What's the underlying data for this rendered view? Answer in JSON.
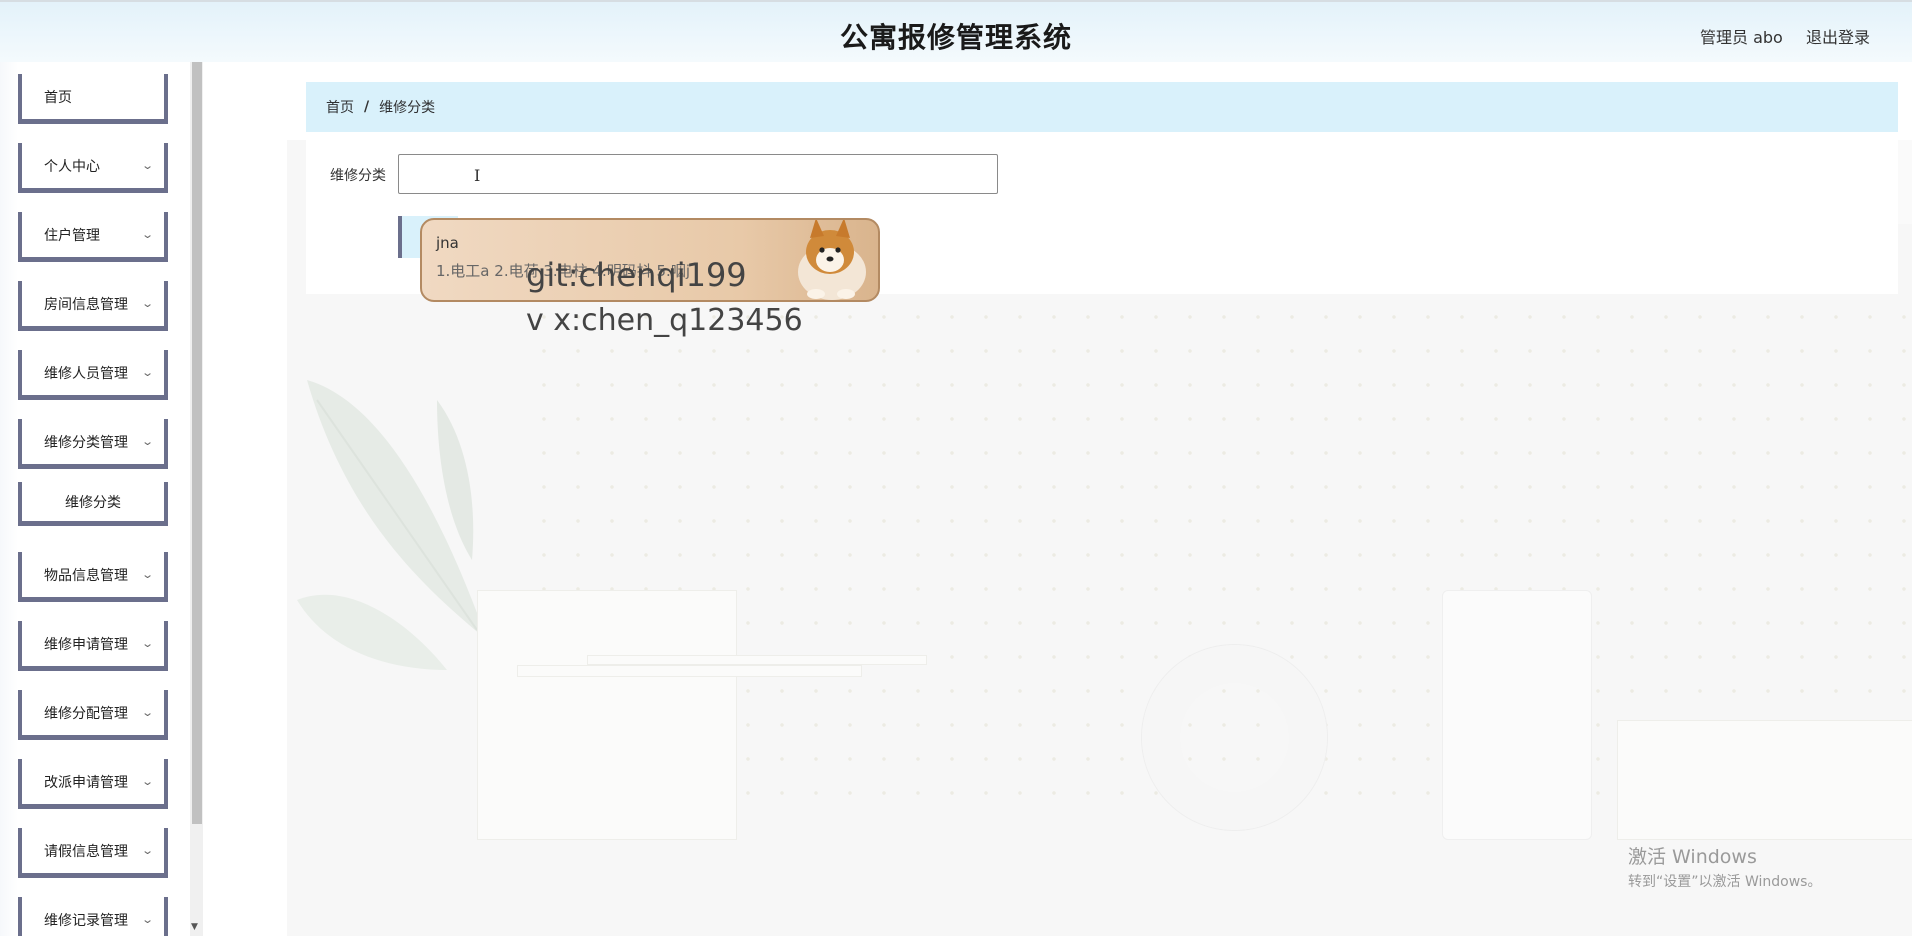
{
  "header": {
    "title": "公寓报修管理系统",
    "user": "管理员 abo",
    "logout": "退出登录"
  },
  "sidebar": {
    "items": [
      {
        "label": "首页",
        "expandable": false
      },
      {
        "label": "个人中心",
        "expandable": true
      },
      {
        "label": "住户管理",
        "expandable": true
      },
      {
        "label": "房间信息管理",
        "expandable": true
      },
      {
        "label": "维修人员管理",
        "expandable": true
      },
      {
        "label": "维修分类管理",
        "expandable": true
      },
      {
        "label": "维修分类",
        "expandable": false,
        "submenu": true
      },
      {
        "label": "物品信息管理",
        "expandable": true
      },
      {
        "label": "维修申请管理",
        "expandable": true
      },
      {
        "label": "维修分配管理",
        "expandable": true
      },
      {
        "label": "改派申请管理",
        "expandable": true
      },
      {
        "label": "请假信息管理",
        "expandable": true
      },
      {
        "label": "维修记录管理",
        "expandable": true
      }
    ]
  },
  "breadcrumb": {
    "home": "首页",
    "separator": "/",
    "current": "维修分类"
  },
  "form": {
    "label": "维修分类",
    "value": ""
  },
  "ime": {
    "composition": "jna",
    "candidates": "1.电工a  2.电荷  3.电柱  4.明码抖  5.咽j"
  },
  "watermark": {
    "line1": "git:chenqi199",
    "line2": "v x:chen_q123456"
  },
  "activation": {
    "line1": "激活 Windows",
    "line2": "转到“设置”以激活 Windows。"
  },
  "colors": {
    "header_bg": "#e3f2fa",
    "breadcrumb_bg": "#d9f1fb",
    "menu_border": "#6b6f8c",
    "ime_bg": "#e8c9a8"
  }
}
